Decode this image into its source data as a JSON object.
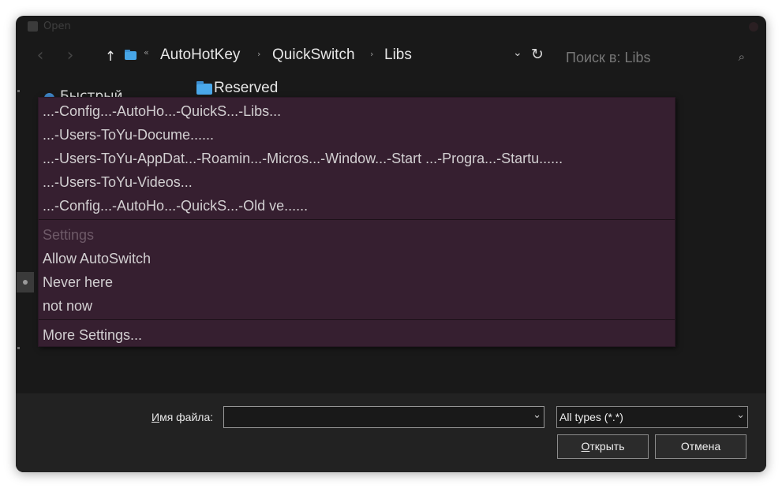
{
  "window": {
    "title": "Open"
  },
  "nav": {
    "back_icon": "chevron-left-icon",
    "forward_icon": "chevron-right-icon",
    "up_icon": "arrow-up-icon",
    "crumb_prefix": "«",
    "breadcrumbs": [
      "AutoHotKey",
      "QuickSwitch",
      "Libs"
    ],
    "crumb_separator": "›",
    "search_placeholder": "Поиск в: Libs"
  },
  "sidebar": {
    "partial_item_label": "Быстрый"
  },
  "files": {
    "first_item": "Reserved"
  },
  "menu": {
    "paths": [
      "...-Config...-AutoHo...-QuickS...-Libs...",
      "...-Users-ToYu-Docume......",
      "...-Users-ToYu-AppDat...-Roamin...-Micros...-Window...-Start ...-Progra...-Startu......",
      "...-Users-ToYu-Videos...",
      "...-Config...-AutoHo...-QuickS...-Old ve......"
    ],
    "settings_header": "Settings",
    "settings": [
      "Allow AutoSwitch",
      "Never here",
      "not now"
    ],
    "checked_setting_index": 1,
    "more_settings": "More Settings..."
  },
  "footer": {
    "filename_label_hotkey": "И",
    "filename_label_rest": "мя файла:",
    "filename_value": "",
    "type_value": "All types (*.*)",
    "open_hotkey": "О",
    "open_rest": "ткрыть",
    "cancel_label": "Отмена"
  },
  "colors": {
    "menu_bg": "#361f30",
    "window_bg": "#191919",
    "footer_bg": "#222222",
    "folder_blue": "#47a5e6"
  }
}
